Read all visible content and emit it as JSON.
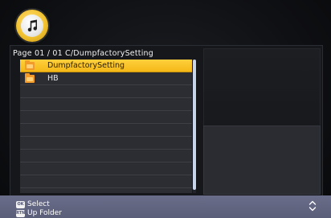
{
  "header": {
    "icon": "music-note-icon"
  },
  "browser": {
    "path_label": "Page  01 / 01 C/DumpfactorySetting",
    "items": [
      {
        "label": "DumpfactorySetting",
        "icon": "folder-icon",
        "selected": true
      },
      {
        "label": "HB",
        "icon": "folder-icon",
        "selected": false
      }
    ],
    "colors": {
      "selection": "#f4b817",
      "folder": "#f29a2a",
      "bottom_bar": "#5f6280"
    }
  },
  "footer": {
    "select_key": "OK",
    "select_label": "Select",
    "up_key": "RTN",
    "up_label": "Up Folder",
    "nav_icon": "up-down-arrows-icon"
  }
}
